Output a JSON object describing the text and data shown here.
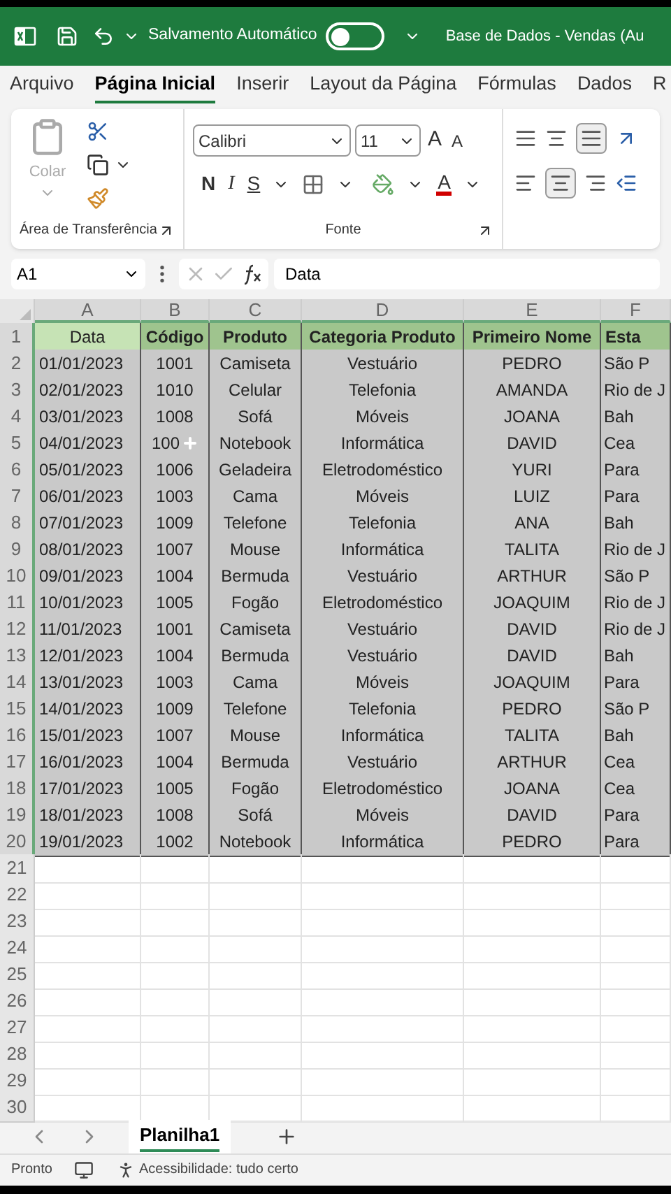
{
  "title_bar": {
    "autosave_label": "Salvamento Automático",
    "autosave_on": false,
    "document_title": "Base de Dados - Vendas (Au"
  },
  "menu_tabs": [
    {
      "label": "Arquivo",
      "selected": false
    },
    {
      "label": "Página Inicial",
      "selected": true
    },
    {
      "label": "Inserir",
      "selected": false
    },
    {
      "label": "Layout da Página",
      "selected": false
    },
    {
      "label": "Fórmulas",
      "selected": false
    },
    {
      "label": "Dados",
      "selected": false
    },
    {
      "label": "R",
      "selected": false
    }
  ],
  "ribbon": {
    "paste_label": "Colar",
    "clipboard_group": "Área de Transferência",
    "font_name": "Calibri",
    "font_size": "11",
    "grow_font": "A",
    "shrink_font": "A",
    "bold": "N",
    "italic": "I",
    "underline": "S",
    "font_color": "A",
    "font_group": "Fonte"
  },
  "formula_bar": {
    "name_box": "A1",
    "formula": "Data"
  },
  "columns": [
    "A",
    "B",
    "C",
    "D",
    "E",
    "F"
  ],
  "header_row": {
    "number": "1",
    "cells": [
      {
        "text": "Data",
        "selected": true
      },
      {
        "text": "Código",
        "selected": false
      },
      {
        "text": "Produto",
        "selected": false
      },
      {
        "text": "Categoria Produto",
        "selected": false
      },
      {
        "text": "Primeiro Nome",
        "selected": false
      },
      {
        "text": "Esta",
        "selected": false
      }
    ]
  },
  "rows": [
    {
      "number": "2",
      "cells": [
        "01/01/2023",
        "1001",
        "Camiseta",
        "Vestuário",
        "PEDRO",
        "São P"
      ]
    },
    {
      "number": "3",
      "cells": [
        "02/01/2023",
        "1010",
        "Celular",
        "Telefonia",
        "AMANDA",
        "Rio de J"
      ]
    },
    {
      "number": "4",
      "cells": [
        "03/01/2023",
        "1008",
        "Sofá",
        "Móveis",
        "JOANA",
        "Bah"
      ]
    },
    {
      "number": "5",
      "cells": [
        "04/01/2023",
        "100",
        "Notebook",
        "Informática",
        "DAVID",
        "Cea"
      ]
    },
    {
      "number": "6",
      "cells": [
        "05/01/2023",
        "1006",
        "Geladeira",
        "Eletrodoméstico",
        "YURI",
        "Para"
      ]
    },
    {
      "number": "7",
      "cells": [
        "06/01/2023",
        "1003",
        "Cama",
        "Móveis",
        "LUIZ",
        "Para"
      ]
    },
    {
      "number": "8",
      "cells": [
        "07/01/2023",
        "1009",
        "Telefone",
        "Telefonia",
        "ANA",
        "Bah"
      ]
    },
    {
      "number": "9",
      "cells": [
        "08/01/2023",
        "1007",
        "Mouse",
        "Informática",
        "TALITA",
        "Rio de J"
      ]
    },
    {
      "number": "10",
      "cells": [
        "09/01/2023",
        "1004",
        "Bermuda",
        "Vestuário",
        "ARTHUR",
        "São P"
      ]
    },
    {
      "number": "11",
      "cells": [
        "10/01/2023",
        "1005",
        "Fogão",
        "Eletrodoméstico",
        "JOAQUIM",
        "Rio de J"
      ]
    },
    {
      "number": "12",
      "cells": [
        "11/01/2023",
        "1001",
        "Camiseta",
        "Vestuário",
        "DAVID",
        "Rio de J"
      ]
    },
    {
      "number": "13",
      "cells": [
        "12/01/2023",
        "1004",
        "Bermuda",
        "Vestuário",
        "DAVID",
        "Bah"
      ]
    },
    {
      "number": "14",
      "cells": [
        "13/01/2023",
        "1003",
        "Cama",
        "Móveis",
        "JOAQUIM",
        "Para"
      ]
    },
    {
      "number": "15",
      "cells": [
        "14/01/2023",
        "1009",
        "Telefone",
        "Telefonia",
        "PEDRO",
        "São P"
      ]
    },
    {
      "number": "16",
      "cells": [
        "15/01/2023",
        "1007",
        "Mouse",
        "Informática",
        "TALITA",
        "Bah"
      ]
    },
    {
      "number": "17",
      "cells": [
        "16/01/2023",
        "1004",
        "Bermuda",
        "Vestuário",
        "ARTHUR",
        "Cea"
      ]
    },
    {
      "number": "18",
      "cells": [
        "17/01/2023",
        "1005",
        "Fogão",
        "Eletrodoméstico",
        "JOANA",
        "Cea"
      ]
    },
    {
      "number": "19",
      "cells": [
        "18/01/2023",
        "1008",
        "Sofá",
        "Móveis",
        "DAVID",
        "Para"
      ]
    },
    {
      "number": "20",
      "cells": [
        "19/01/2023",
        "1002",
        "Notebook",
        "Informática",
        "PEDRO",
        "Para"
      ]
    }
  ],
  "empty_rows": [
    "21",
    "22",
    "23",
    "24",
    "25",
    "26",
    "27",
    "28",
    "29",
    "30"
  ],
  "sheet_tabs": [
    {
      "label": "Planilha1",
      "selected": true
    }
  ],
  "status_bar": {
    "status": "Pronto",
    "accessibility": "Acessibilidade: tudo certo"
  }
}
